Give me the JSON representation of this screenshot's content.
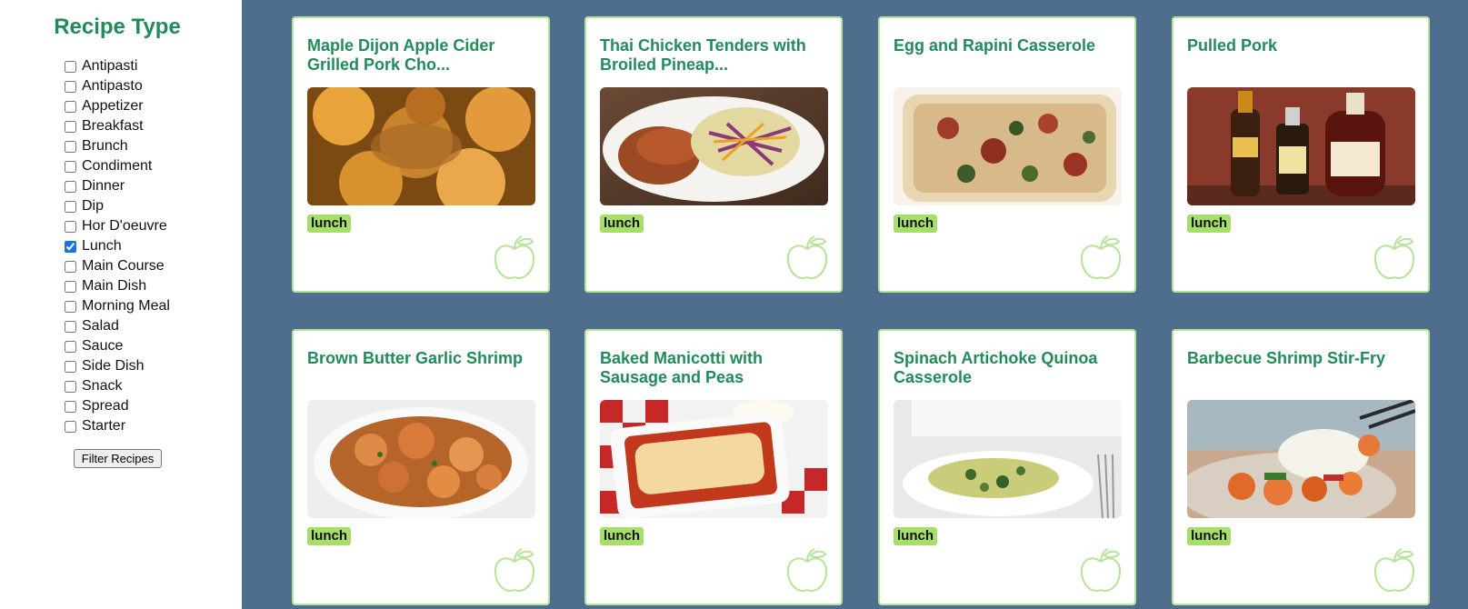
{
  "sidebar": {
    "title": "Recipe Type",
    "filters": [
      {
        "label": "Antipasti",
        "checked": false
      },
      {
        "label": "Antipasto",
        "checked": false
      },
      {
        "label": "Appetizer",
        "checked": false
      },
      {
        "label": "Breakfast",
        "checked": false
      },
      {
        "label": "Brunch",
        "checked": false
      },
      {
        "label": "Condiment",
        "checked": false
      },
      {
        "label": "Dinner",
        "checked": false
      },
      {
        "label": "Dip",
        "checked": false
      },
      {
        "label": "Hor D'oeuvre",
        "checked": false
      },
      {
        "label": "Lunch",
        "checked": true
      },
      {
        "label": "Main Course",
        "checked": false
      },
      {
        "label": "Main Dish",
        "checked": false
      },
      {
        "label": "Morning Meal",
        "checked": false
      },
      {
        "label": "Salad",
        "checked": false
      },
      {
        "label": "Sauce",
        "checked": false
      },
      {
        "label": "Side Dish",
        "checked": false
      },
      {
        "label": "Snack",
        "checked": false
      },
      {
        "label": "Spread",
        "checked": false
      },
      {
        "label": "Starter",
        "checked": false
      }
    ],
    "button_label": "Filter Recipes"
  },
  "cards": [
    {
      "title": "Maple Dijon Apple Cider Grilled Pork Cho...",
      "tag": "lunch",
      "image": "pork-apple-photo"
    },
    {
      "title": "Thai Chicken Tenders with Broiled Pineap...",
      "tag": "lunch",
      "image": "chicken-slaw-photo"
    },
    {
      "title": "Egg and Rapini Casserole",
      "tag": "lunch",
      "image": "casserole-photo"
    },
    {
      "title": "Pulled Pork",
      "tag": "lunch",
      "image": "sauce-bottles-photo"
    },
    {
      "title": "Brown Butter Garlic Shrimp",
      "tag": "lunch",
      "image": "shrimp-bowl-photo"
    },
    {
      "title": "Baked Manicotti with Sausage and Peas",
      "tag": "lunch",
      "image": "manicotti-photo"
    },
    {
      "title": "Spinach Artichoke Quinoa Casserole",
      "tag": "lunch",
      "image": "quinoa-photo"
    },
    {
      "title": "Barbecue Shrimp Stir-Fry",
      "tag": "lunch",
      "image": "stirfry-photo"
    }
  ],
  "icons": {
    "card_icon": "apple-outline-icon"
  },
  "colors": {
    "accent_green": "#228b5a",
    "tag_green": "#a6de6a",
    "card_border": "#b5e39a",
    "background": "#4f6d8c"
  }
}
